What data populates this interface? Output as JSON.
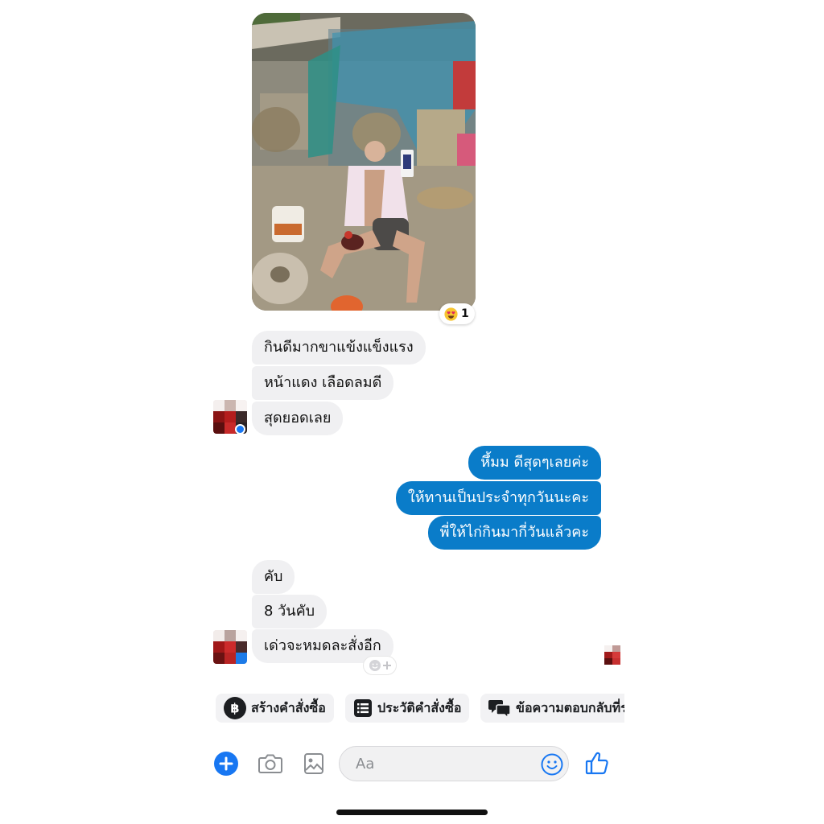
{
  "conversation": {
    "photo": {
      "alt": "",
      "reaction": {
        "emoji": "heart-eyes",
        "count": "1"
      }
    },
    "incoming_group_1": [
      "กินดีมากขาแข้งแข็งแรง",
      "หน้าแดง เลือดลมดี",
      "สุดยอดเลย"
    ],
    "outgoing_group": [
      "หึ้มม ดีสุดๆเลยค่ะ",
      "ให้ทานเป็นประจำทุกวันนะคะ",
      "พี่ให้ไก่กินมากี่วันแล้วคะ"
    ],
    "incoming_group_2": [
      "คับ",
      "8 วันคับ",
      "เด่วจะหมดละสั่งอีก"
    ]
  },
  "quick_actions": [
    {
      "label": "สร้างคำสั่งซื้อ",
      "icon": "baht-icon"
    },
    {
      "label": "ประวัติคำสั่งซื้อ",
      "icon": "order-list-icon"
    },
    {
      "label": "ข้อความตอบกลับที่ร",
      "icon": "saved-replies-icon"
    }
  ],
  "composer": {
    "placeholder": "Aa",
    "buttons": [
      "plus-icon",
      "camera-icon",
      "gallery-icon",
      "emoji-icon",
      "like-icon"
    ]
  },
  "colors": {
    "outgoing_bubble": "#0a7cc9",
    "incoming_bubble": "#f0f0f2",
    "accent": "#1877f2"
  }
}
